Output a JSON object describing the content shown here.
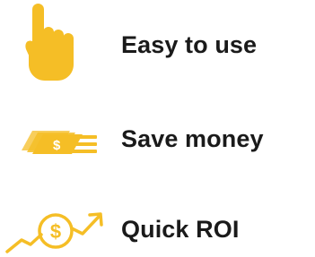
{
  "colors": {
    "accent": "#F5BE26",
    "text": "#1A1A1A",
    "background": "#FFFFFF"
  },
  "features": [
    {
      "icon": "pointing-hand-icon",
      "label": "Easy to use"
    },
    {
      "icon": "money-stack-icon",
      "label": "Save money"
    },
    {
      "icon": "dollar-growth-arrow-icon",
      "label": "Quick ROI"
    }
  ]
}
